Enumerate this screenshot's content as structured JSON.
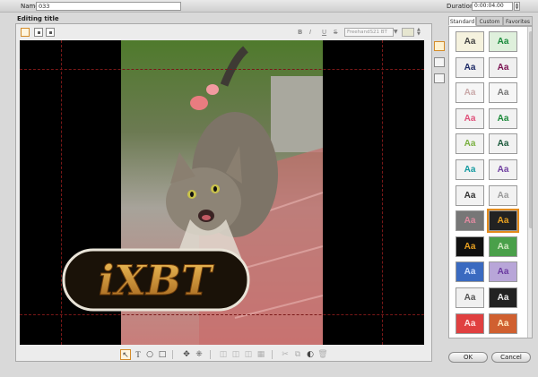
{
  "header": {
    "name_label": "Name:",
    "name_value": "033",
    "duration_label": "Duration:",
    "duration_value": "0:00:04.00"
  },
  "editor": {
    "title": "Editing title",
    "font_name": "FreehandS21 BT",
    "bold_label": "B",
    "italic_label": "I",
    "underline_label": "U",
    "strike_label": "S"
  },
  "overlay_text": "iXBT",
  "tabs": [
    "Standard",
    "Custom",
    "Favorites"
  ],
  "swatch_label": "Aa",
  "swatch_styles": [
    [
      "#f5f2de",
      "#444"
    ],
    [
      "#dff0dc",
      "#1a8a3c"
    ],
    [
      "#f0f0f0",
      "#1d2a66"
    ],
    [
      "#f0f0f0",
      "#7a1050"
    ],
    [
      "#f6f6f6",
      "#c9a8a8"
    ],
    [
      "#f6f6f6",
      "#777777"
    ],
    [
      "#f2f2f2",
      "#e0507a"
    ],
    [
      "#f2f2f2",
      "#1c8a3a"
    ],
    [
      "#f2f2f2",
      "#7ab040"
    ],
    [
      "#f2f2f2",
      "#1c5a3c"
    ],
    [
      "#f2f2f2",
      "#159aa0"
    ],
    [
      "#f2f2f2",
      "#7040a0"
    ],
    [
      "#f2f2f2",
      "#333333"
    ],
    [
      "#f2f2f2",
      "#9a9a9a"
    ],
    [
      "#777777",
      "#e08aa0"
    ],
    [
      "#222222",
      "#e8a020"
    ],
    [
      "#111111",
      "#e8a020"
    ],
    [
      "#4aa04a",
      "#cfe8c0"
    ],
    [
      "#3a6ac0",
      "#cfe0ff"
    ],
    [
      "#b8a6d8",
      "#6a3aa0"
    ],
    [
      "#f0f0f0",
      "#555555"
    ],
    [
      "#222222",
      "#eeeeee"
    ],
    [
      "#e04040",
      "#ffe0e0"
    ],
    [
      "#d06030",
      "#ffe8c0"
    ]
  ],
  "buttons": {
    "ok": "OK",
    "cancel": "Cancel"
  }
}
